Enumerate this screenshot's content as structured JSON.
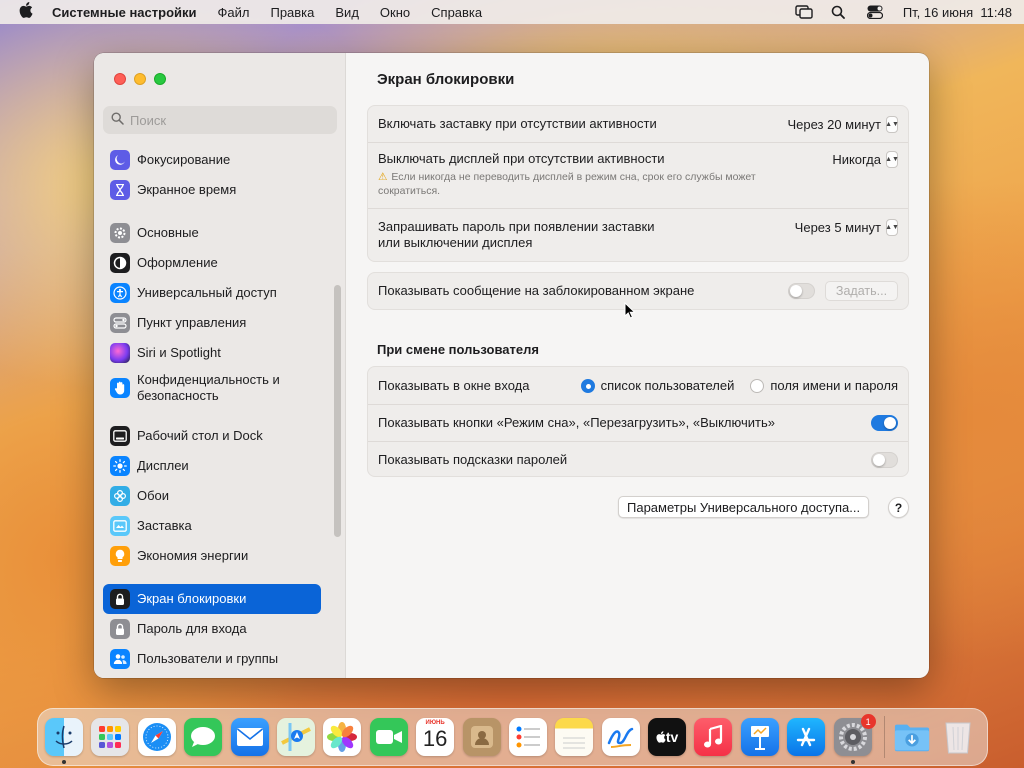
{
  "menubar": {
    "app_name": "Системные настройки",
    "menus": [
      "Файл",
      "Правка",
      "Вид",
      "Окно",
      "Справка"
    ],
    "clock": "Пт, 16 июня  11:48"
  },
  "sidebar": {
    "search_placeholder": "Поиск",
    "items": [
      {
        "label": "Фокусирование",
        "icon": "moon-icon",
        "color": "#5e5ce6"
      },
      {
        "label": "Экранное время",
        "icon": "hourglass-icon",
        "color": "#5e5ce6"
      },
      {
        "label": "Основные",
        "icon": "gear-icon",
        "color": "#8e8e93"
      },
      {
        "label": "Оформление",
        "icon": "appearance-icon",
        "color": "#1d1d1f"
      },
      {
        "label": "Универсальный доступ",
        "icon": "accessibility-icon",
        "color": "#0a84ff"
      },
      {
        "label": "Пункт управления",
        "icon": "control-center-icon",
        "color": "#8e8e93"
      },
      {
        "label": "Siri и Spotlight",
        "icon": "siri-icon",
        "color": "#b444d8"
      },
      {
        "label": "Конфиденциальность и безопасность",
        "icon": "hand-icon",
        "color": "#0a84ff"
      },
      {
        "label": "Рабочий стол и Dock",
        "icon": "desktop-dock-icon",
        "color": "#1d1d1f"
      },
      {
        "label": "Дисплеи",
        "icon": "displays-icon",
        "color": "#0a84ff"
      },
      {
        "label": "Обои",
        "icon": "wallpaper-icon",
        "color": "#32ade6"
      },
      {
        "label": "Заставка",
        "icon": "screensaver-icon",
        "color": "#5ac8fa"
      },
      {
        "label": "Экономия энергии",
        "icon": "bulb-icon",
        "color": "#ff9f0a"
      },
      {
        "label": "Экран блокировки",
        "icon": "lock-icon",
        "color": "#1d1d1f"
      },
      {
        "label": "Пароль для входа",
        "icon": "lock-gray-icon",
        "color": "#8e8e93"
      },
      {
        "label": "Пользователи и группы",
        "icon": "users-icon",
        "color": "#0a84ff"
      }
    ]
  },
  "content": {
    "title": "Экран блокировки",
    "group1": {
      "screensaver_label": "Включать заставку при отсутствии активности",
      "screensaver_value": "Через 20 минут",
      "display_off_label": "Выключать дисплей при отсутствии активности",
      "display_off_value": "Никогда",
      "display_off_note": "Если никогда не переводить дисплей в режим сна, срок его службы может сократиться.",
      "password_label_line1": "Запрашивать пароль при появлении заставки",
      "password_label_line2": "или выключении дисплея",
      "password_value": "Через 5 минут"
    },
    "message_row": {
      "label": "Показывать сообщение на заблокированном экране",
      "toggle_on": false,
      "button": "Задать..."
    },
    "switch_user": {
      "section_title": "При смене пользователя",
      "login_window_label": "Показывать в окне входа",
      "option_list": "список пользователей",
      "option_fields": "поля имени и пароля",
      "selected": "список пользователей",
      "power_buttons_label": "Показывать кнопки «Режим сна», «Перезагрузить», «Выключить»",
      "power_buttons_on": true,
      "hints_label": "Показывать подсказки паролей",
      "hints_on": false
    },
    "accessibility_button": "Параметры Универсального доступа...",
    "help_button": "?"
  },
  "dock": {
    "calendar_month": "ИЮНЬ",
    "calendar_day": "16",
    "settings_badge": "1",
    "apps": [
      "finder",
      "launchpad",
      "safari",
      "messages",
      "mail",
      "maps",
      "photos",
      "facetime",
      "calendar",
      "contacts",
      "reminders",
      "notes",
      "freeform",
      "tv",
      "music",
      "keynote",
      "app-store",
      "system-settings",
      "downloads",
      "trash"
    ],
    "tv_label": "tv"
  }
}
